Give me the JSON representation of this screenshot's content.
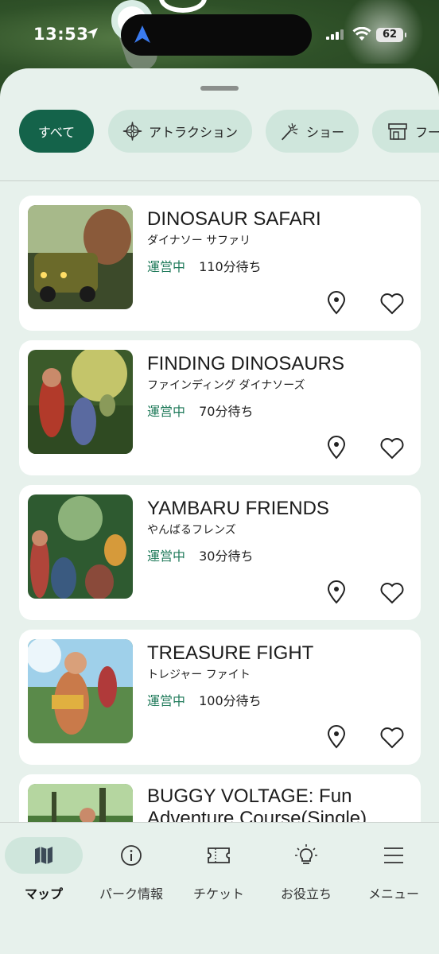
{
  "status_bar": {
    "time": "13:53",
    "battery": "62"
  },
  "filters": [
    {
      "label": "すべて",
      "icon": "all",
      "selected": true
    },
    {
      "label": "アトラクション",
      "icon": "compass-icon",
      "selected": false
    },
    {
      "label": "ショー",
      "icon": "sparkle-wand-icon",
      "selected": false
    },
    {
      "label": "フー",
      "icon": "shop-icon",
      "selected": false
    }
  ],
  "cards": [
    {
      "title": "DINOSAUR SAFARI",
      "subtitle": "ダイナソー サファリ",
      "status": "運営中",
      "wait": "110分待ち"
    },
    {
      "title": "FINDING DINOSAURS",
      "subtitle": "ファインディング ダイナソーズ",
      "status": "運営中",
      "wait": "70分待ち"
    },
    {
      "title": "YAMBARU FRIENDS",
      "subtitle": "やんばるフレンズ",
      "status": "運営中",
      "wait": "30分待ち"
    },
    {
      "title": "TREASURE FIGHT",
      "subtitle": "トレジャー ファイト",
      "status": "運営中",
      "wait": "100分待ち"
    },
    {
      "title": "BUGGY VOLTAGE: Fun Adventure Course(Single)",
      "subtitle": "",
      "status": "",
      "wait": ""
    }
  ],
  "tabs": [
    {
      "label": "マップ",
      "icon": "map-icon",
      "active": true
    },
    {
      "label": "パーク情報",
      "icon": "info-icon",
      "active": false
    },
    {
      "label": "チケット",
      "icon": "ticket-icon",
      "active": false
    },
    {
      "label": "お役立ち",
      "icon": "lightbulb-icon",
      "active": false
    },
    {
      "label": "メニュー",
      "icon": "menu-icon",
      "active": false
    }
  ],
  "colors": {
    "accent": "#14634a",
    "status_open": "#1f7a5a",
    "chip_bg": "#cfe6dc",
    "sheet_bg": "#e7f1ec"
  }
}
